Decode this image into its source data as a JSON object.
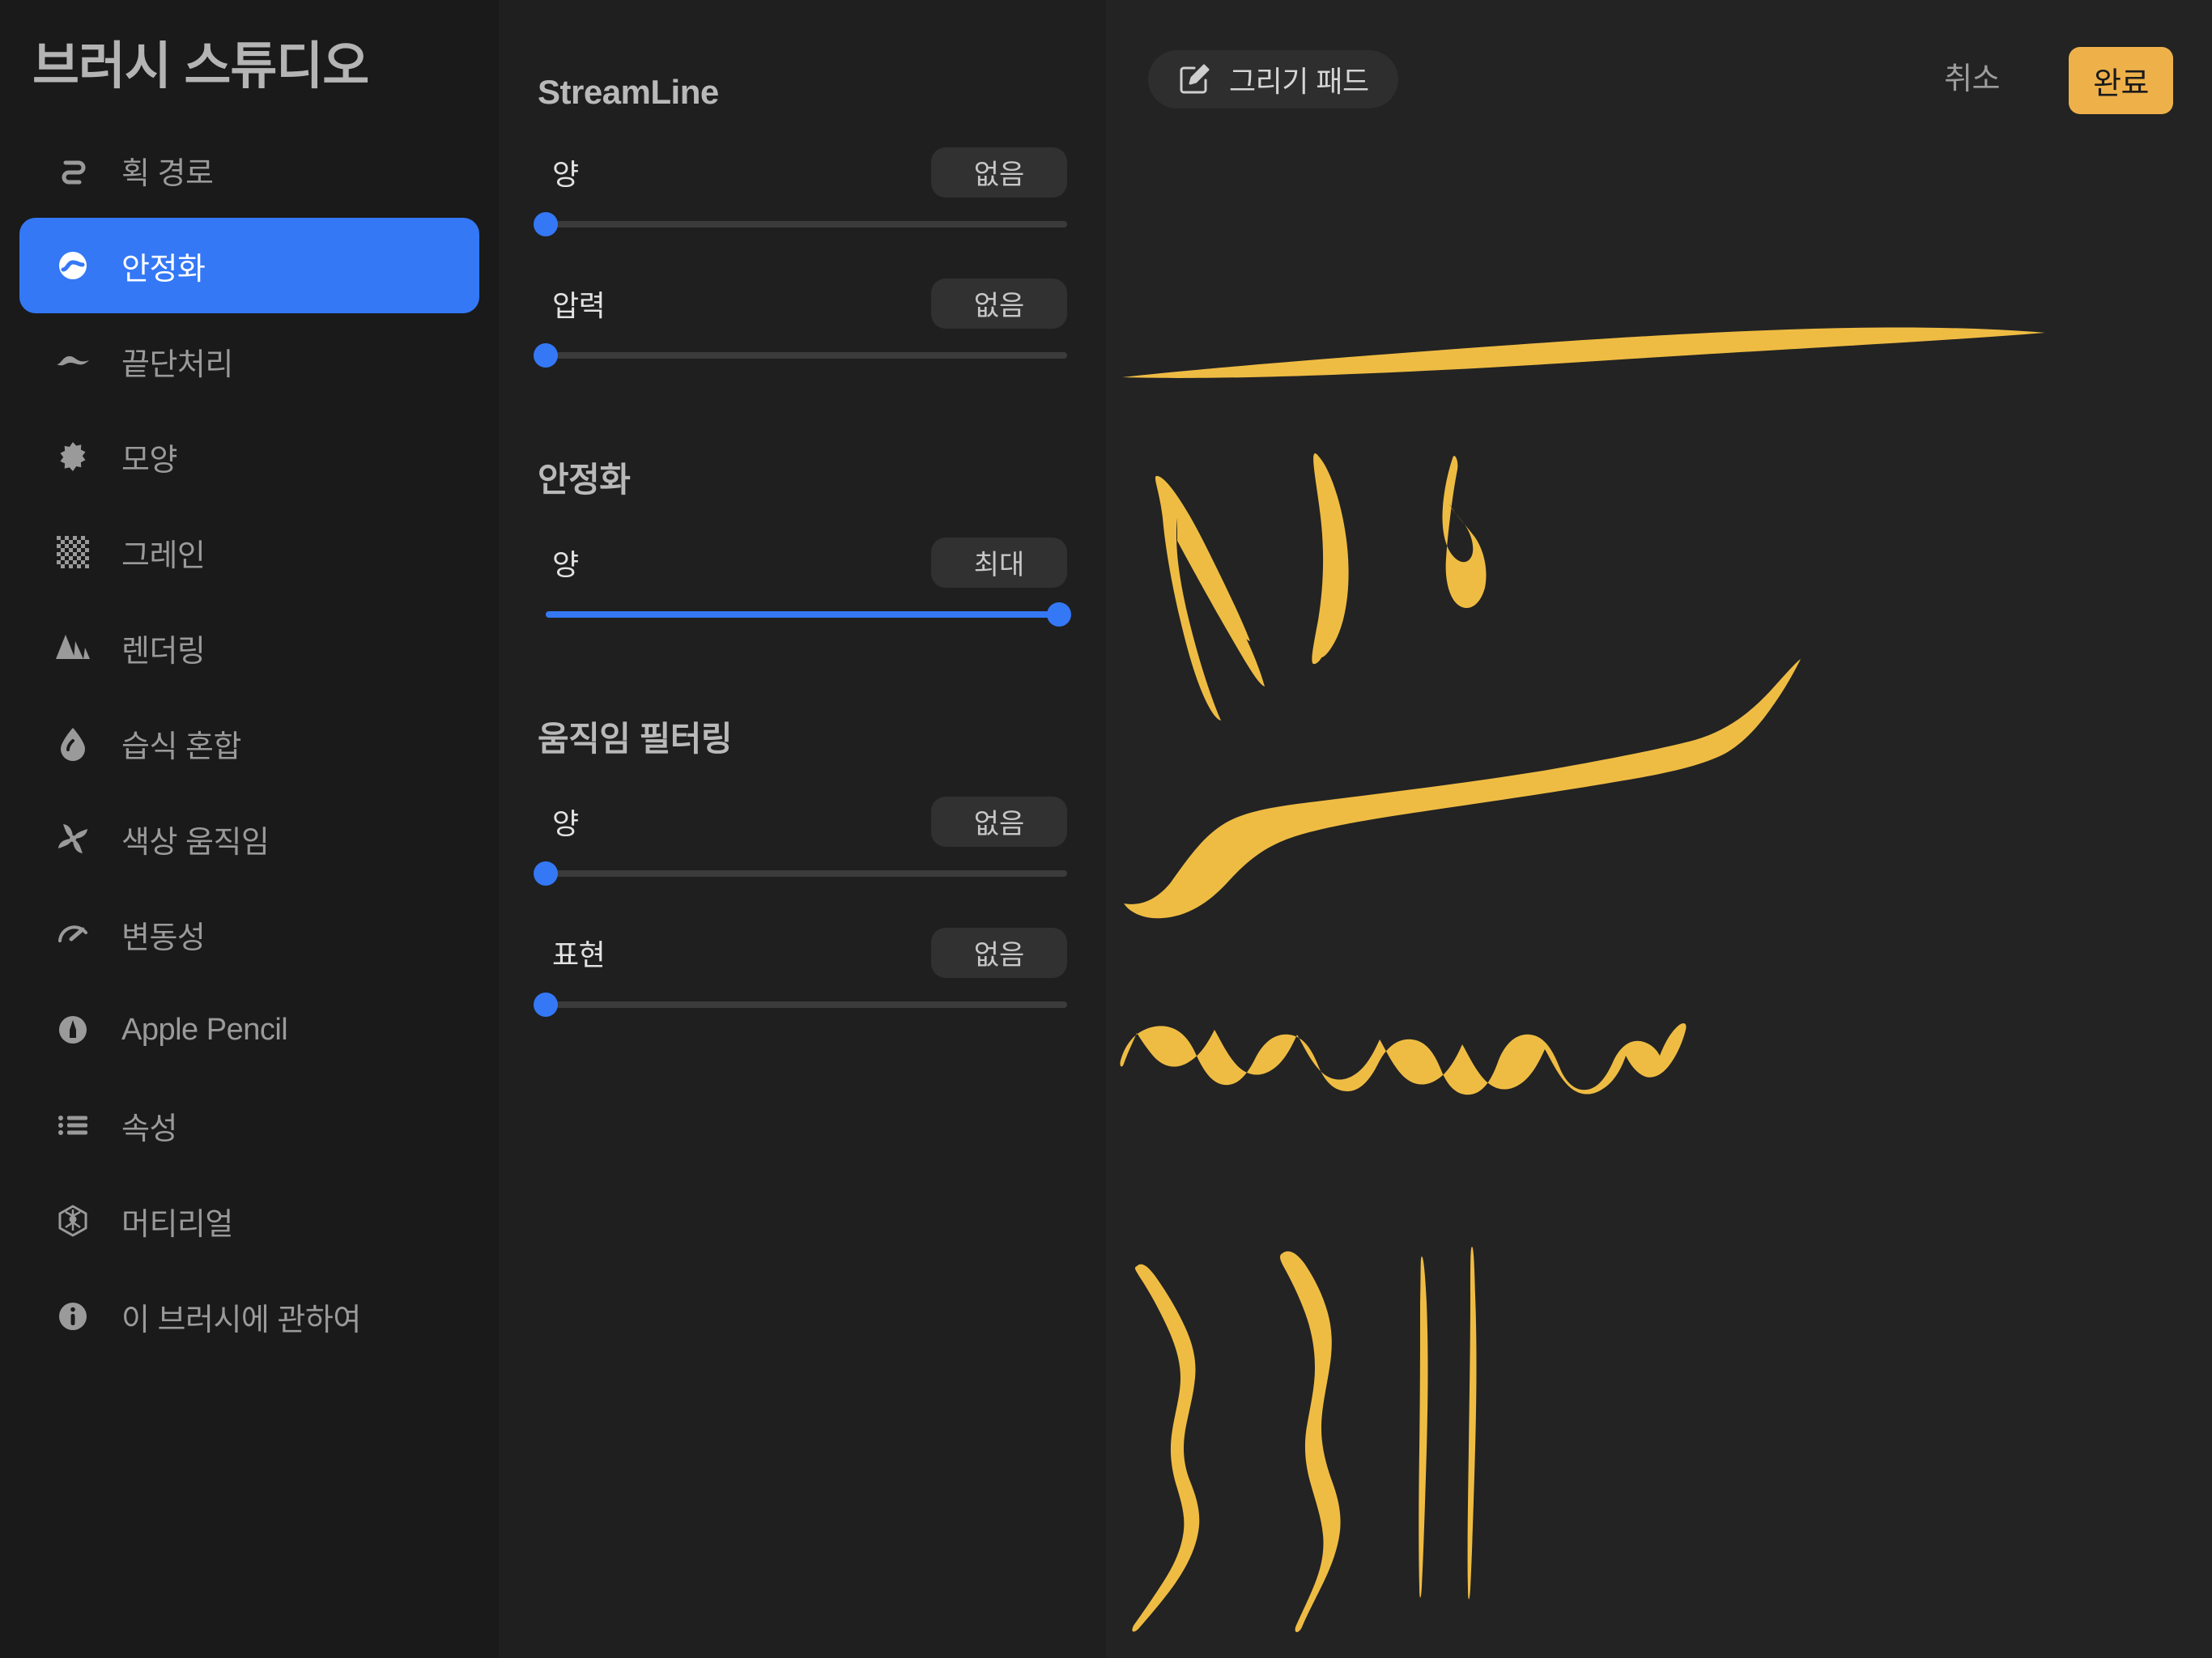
{
  "app": {
    "title": "브러시 스튜디오",
    "accent_blue": "#3478f6",
    "accent_gold": "#eeb14a",
    "stroke_color": "#efbc43",
    "sidebar_bg": "#1a1a1a",
    "panel_bg": "#1f1f1f",
    "canvas_bg": "#232323"
  },
  "sidebar": {
    "items": [
      {
        "label": "획 경로",
        "icon": "stroke-path-icon",
        "active": false
      },
      {
        "label": "안정화",
        "icon": "stabilization-icon",
        "active": true
      },
      {
        "label": "끝단처리",
        "icon": "taper-icon",
        "active": false
      },
      {
        "label": "모양",
        "icon": "shape-icon",
        "active": false
      },
      {
        "label": "그레인",
        "icon": "grain-icon",
        "active": false
      },
      {
        "label": "렌더링",
        "icon": "rendering-icon",
        "active": false
      },
      {
        "label": "습식 혼합",
        "icon": "wet-mix-icon",
        "active": false
      },
      {
        "label": "색상 움직임",
        "icon": "color-dynamics-icon",
        "active": false
      },
      {
        "label": "변동성",
        "icon": "dynamics-icon",
        "active": false
      },
      {
        "label": "Apple Pencil",
        "icon": "apple-pencil-icon",
        "active": false
      },
      {
        "label": "속성",
        "icon": "properties-icon",
        "active": false
      },
      {
        "label": "머티리얼",
        "icon": "materials-icon",
        "active": false
      },
      {
        "label": "이 브러시에 관하여",
        "icon": "info-icon",
        "active": false
      }
    ]
  },
  "settings": {
    "groups": [
      {
        "title": "StreamLine",
        "sliders": [
          {
            "label": "양",
            "value_label": "없음",
            "percent": 0
          },
          {
            "label": "압력",
            "value_label": "없음",
            "percent": 0
          }
        ]
      },
      {
        "title": "안정화",
        "sliders": [
          {
            "label": "양",
            "value_label": "최대",
            "percent": 100
          }
        ]
      },
      {
        "title": "움직임 필터링",
        "sliders": [
          {
            "label": "양",
            "value_label": "없음",
            "percent": 0
          },
          {
            "label": "표현",
            "value_label": "없음",
            "percent": 0
          }
        ]
      }
    ]
  },
  "canvas": {
    "draw_pad_label": "그리기 패드",
    "draw_pad_icon": "pencil-square-icon",
    "cancel_label": "취소",
    "done_label": "완료"
  }
}
